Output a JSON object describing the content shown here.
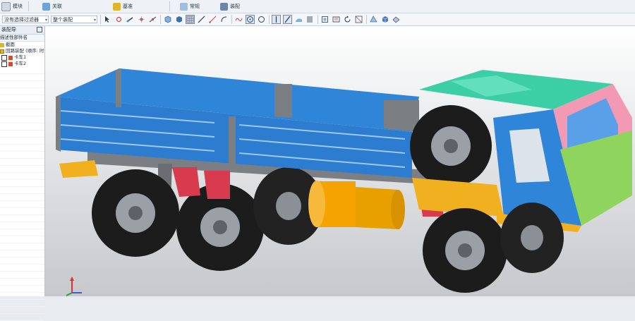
{
  "ribbon": {
    "groups": [
      {
        "label": "模块"
      },
      {
        "label": "关联"
      },
      {
        "label": "基准"
      },
      {
        "label": "常规"
      },
      {
        "label": "装配"
      }
    ]
  },
  "command_bar": {
    "filter_value": "没有选择过滤器",
    "assembly_value": "整个装配",
    "dropdown_arrow": "▾"
  },
  "navigator": {
    "title": "装配导",
    "column_header": "描述性部件名",
    "items": [
      {
        "label": "截面",
        "icon": "folder-icon",
        "color": "#e0b52e"
      },
      {
        "label": "回路装配 (顺序: 时",
        "icon": "assembly-icon",
        "color": "#e0b52e"
      },
      {
        "label": "卡车1",
        "icon": "part-icon",
        "color": "#d84a2a"
      },
      {
        "label": "卡车2",
        "icon": "part-icon",
        "color": "#d84a2a"
      }
    ]
  },
  "viewport": {
    "background_top": "#ffffff",
    "background_bottom": "#c6c8cb",
    "colors": {
      "cargo_box": "#2f86d8",
      "cab_teal": "#3ccfa5",
      "cab_pink": "#f29ab3",
      "cab_green": "#8fd45c",
      "tire": "#1c1c1c",
      "rim": "#9aa0a6",
      "axle_red": "#d93b4e",
      "frame_yellow": "#f0b020",
      "tank_orange": "#f5a300",
      "chassis_grey": "#7b7f84"
    }
  },
  "triad": {
    "z_color": "#e03030",
    "x_color": "#3a5fd0",
    "y_color": "#2e9e3e"
  }
}
